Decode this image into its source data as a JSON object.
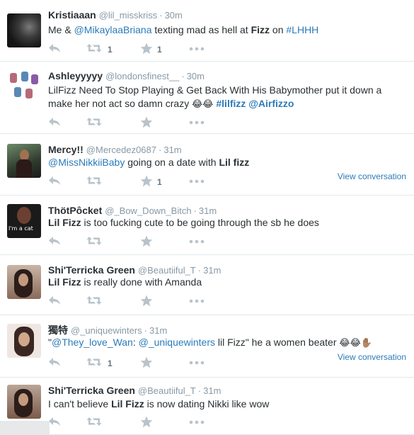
{
  "tweets": [
    {
      "name": "Kristiaaan",
      "handle": "@lil_misskriss",
      "dot": "·",
      "time": "30m",
      "text": [
        {
          "t": "Me & "
        },
        {
          "t": "@MikaylaaBriana",
          "cls": "mention"
        },
        {
          "t": " texting mad as hell at "
        },
        {
          "t": "Fizz",
          "cls": "b"
        },
        {
          "t": " on "
        },
        {
          "t": "#LHHH",
          "cls": "hashtag"
        }
      ],
      "retweets": "1",
      "favorites": "1",
      "view_conversation": ""
    },
    {
      "name": "Ashleyyyyy",
      "handle": "@londonsfinest__",
      "dot": "·",
      "time": "30m",
      "text": [
        {
          "t": "LilFizz Need To Stop Playing & Get Back With His Babymother put it down a make her not act so damn crazy "
        },
        {
          "t": "😂😂",
          "cls": "emoji"
        },
        {
          "t": " "
        },
        {
          "t": "#lilfizz",
          "cls": "bl"
        },
        {
          "t": " "
        },
        {
          "t": "@Airfizzo",
          "cls": "bl"
        }
      ],
      "retweets": "",
      "favorites": "",
      "view_conversation": ""
    },
    {
      "name": "Mercy!!",
      "handle": "@Mercedez0687",
      "dot": "·",
      "time": "31m",
      "text": [
        {
          "t": "@MissNikkiiBaby",
          "cls": "mention"
        },
        {
          "t": " going on a date with "
        },
        {
          "t": "Lil fizz",
          "cls": "b"
        }
      ],
      "retweets": "",
      "favorites": "1",
      "view_conversation": "View conversation"
    },
    {
      "name": "ThötPôcket",
      "handle": "@_Bow_Down_Bitch",
      "dot": "·",
      "time": "31m",
      "text": [
        {
          "t": "Lil Fizz",
          "cls": "b"
        },
        {
          "t": " is too fucking cute to be going through the sb he does"
        }
      ],
      "retweets": "",
      "favorites": "",
      "view_conversation": "",
      "avatar_caption": "I'm a cat"
    },
    {
      "name": "Shi'Terricka Green",
      "handle": "@Beautiiful_T",
      "dot": "·",
      "time": "31m",
      "text": [
        {
          "t": "Lil Fizz",
          "cls": "b"
        },
        {
          "t": " is really done with Amanda"
        }
      ],
      "retweets": "",
      "favorites": "",
      "view_conversation": ""
    },
    {
      "name": "獨特",
      "handle": "@_uniquewinters",
      "dot": "·",
      "time": "31m",
      "text": [
        {
          "t": "\""
        },
        {
          "t": "@They_love_Wan",
          "cls": "mention"
        },
        {
          "t": ": "
        },
        {
          "t": "@_uniquewinters",
          "cls": "mention"
        },
        {
          "t": " lil Fizz\" he a women beater "
        },
        {
          "t": "😂😂✋🏽",
          "cls": "emoji"
        }
      ],
      "retweets": "1",
      "favorites": "",
      "view_conversation": "View conversation"
    },
    {
      "name": "Shi'Terricka Green",
      "handle": "@Beautiiful_T",
      "dot": "·",
      "time": "31m",
      "text": [
        {
          "t": "I can't believe "
        },
        {
          "t": "Lil Fizz",
          "cls": "b"
        },
        {
          "t": " is now dating Nikki like wow"
        }
      ],
      "retweets": "",
      "favorites": "",
      "view_conversation": ""
    }
  ]
}
